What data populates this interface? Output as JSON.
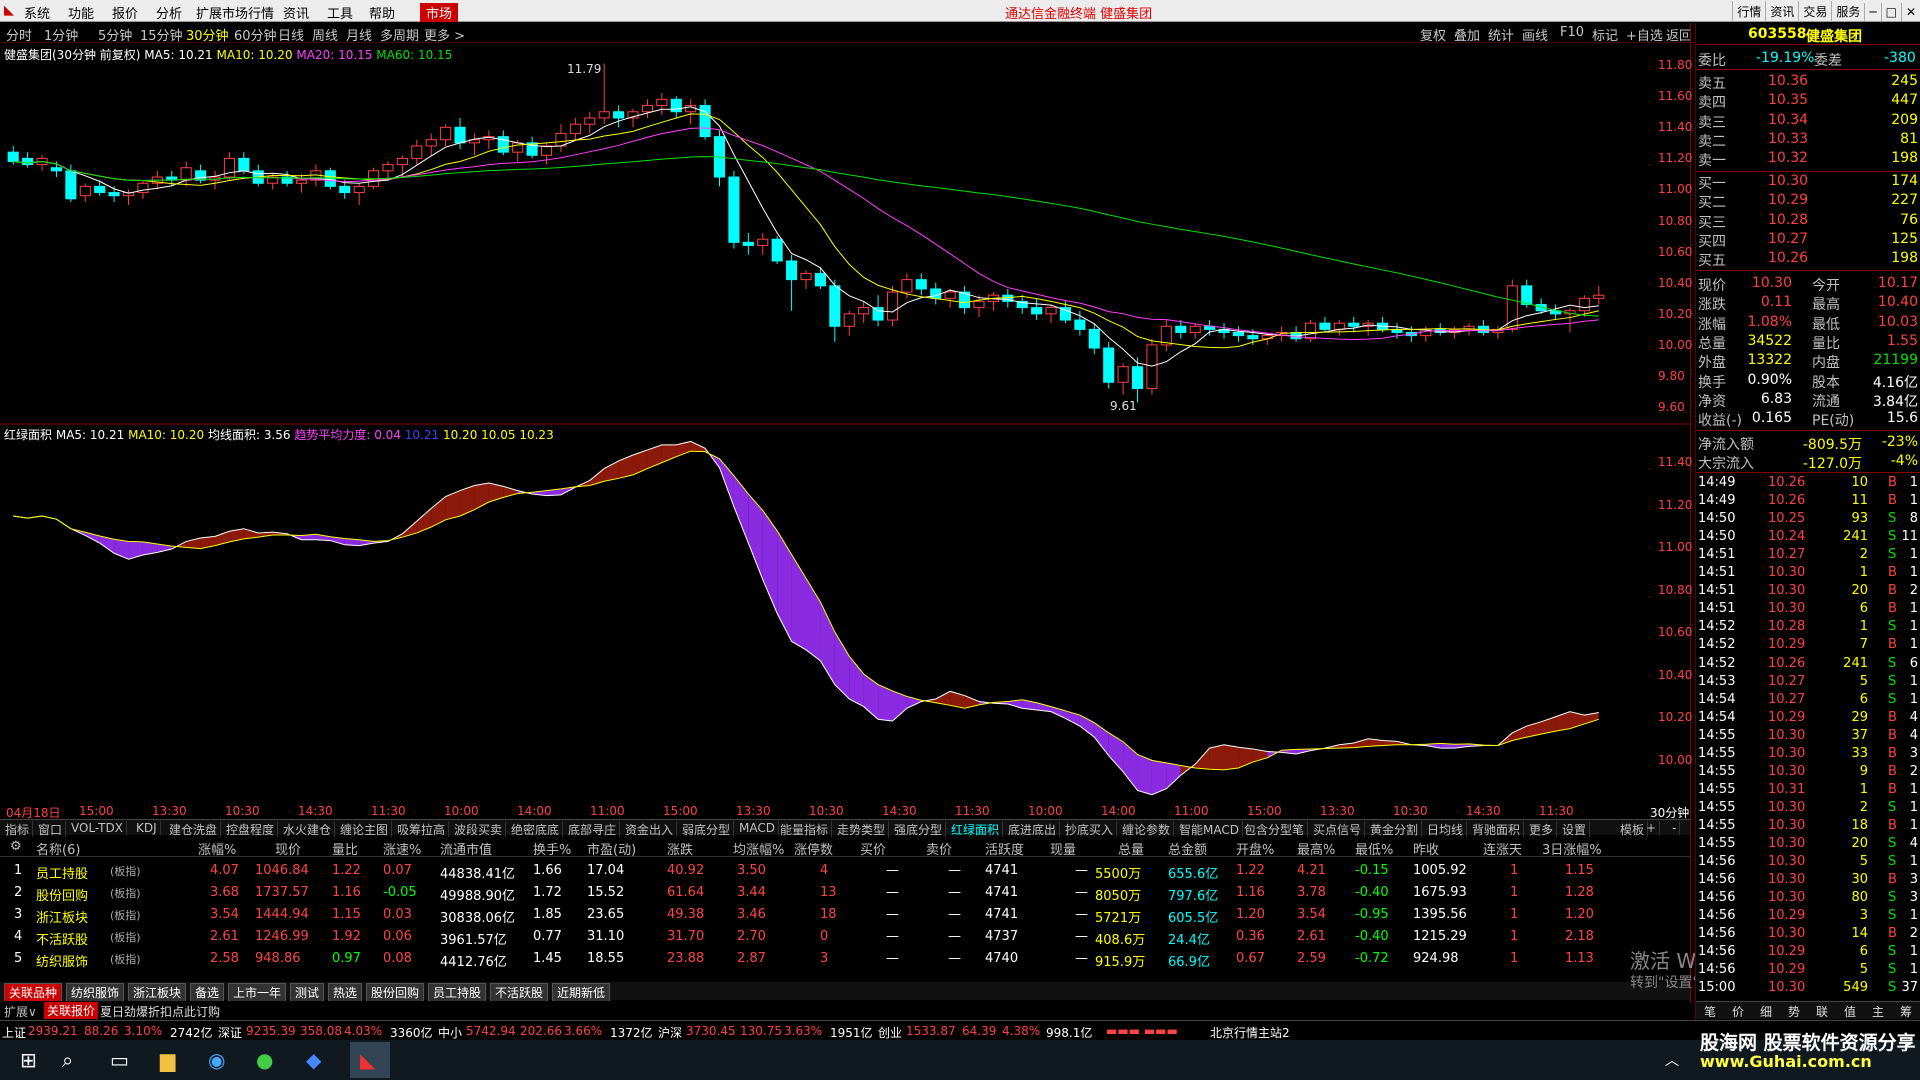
{
  "menu": {
    "items": [
      "系统",
      "功能",
      "报价",
      "分析",
      "扩展市场行情",
      "资讯",
      "工具",
      "帮助",
      "市场"
    ],
    "title": "通达信金融终端  健盛集团",
    "right": [
      "行情",
      "资讯",
      "交易",
      "服务"
    ]
  },
  "timeframes": [
    "分时",
    "1分钟",
    "5分钟",
    "15分钟",
    "30分钟",
    "60分钟",
    "日线",
    "周线",
    "月线",
    "多周期",
    "更多 >"
  ],
  "tf_right": [
    "复权",
    "叠加",
    "统计",
    "画线",
    "F10",
    "标记",
    "+自选",
    "返回"
  ],
  "kinfo": {
    "name": "健盛集团(30分钟 前复权)",
    "ma5": "MA5: 10.21",
    "ma10": "MA10: 10.20",
    "ma20": "MA20: 10.15",
    "ma60": "MA60: 10.15"
  },
  "k_high": "11.79",
  "k_low": "9.61",
  "axis1": [
    "11.80",
    "11.60",
    "11.40",
    "11.20",
    "11.00",
    "10.80",
    "10.60",
    "10.40",
    "10.20",
    "10.00",
    "9.80",
    "9.60"
  ],
  "ind2": {
    "name": "红绿面积",
    "ma5": "MA5: 10.21",
    "ma10": "MA10: 10.20",
    "area": "均线面积: 3.56",
    "trend": "趋势平均力度: 0.04",
    "v1": "10.21",
    "v2": "10.20",
    "v3": "10.05",
    "v4": "10.23"
  },
  "axis2": [
    "11.40",
    "11.20",
    "11.00",
    "10.80",
    "10.60",
    "10.40",
    "10.20",
    "10.00"
  ],
  "timeaxis": [
    "04月18日",
    "15:00",
    "13:30",
    "10:30",
    "14:30",
    "11:30",
    "10:00",
    "14:00",
    "11:00",
    "15:00",
    "13:30",
    "10:30",
    "14:30",
    "11:30",
    "10:00",
    "14:00",
    "11:00",
    "15:00",
    "13:30",
    "10:30",
    "14:30",
    "11:30"
  ],
  "timeaxis_right": "30分钟",
  "indtabs": [
    "指标",
    "窗口",
    "VOL-TDX",
    "KDJ",
    "建仓洗盘",
    "控盘程度",
    "水火建仓",
    "缠论主图",
    "吸筹拉高",
    "波段买卖",
    "绝密底底",
    "底部寻庄",
    "资金出入",
    "弱底分型",
    "MACD",
    "能量指标",
    "走势类型",
    "强底分型",
    "红绿面积",
    "底进底出",
    "抄底买入",
    "缠论参数",
    "智能MACD",
    "包含分型笔",
    "买点信号",
    "黄金分割",
    "日均线",
    "背驰面积",
    "更多",
    "设置"
  ],
  "indtabs_right": [
    "模板",
    "+",
    "-"
  ],
  "table": {
    "headers": [
      "名称(6)",
      "涨幅%",
      "现价",
      "量比",
      "涨速%",
      "流通市值",
      "换手%",
      "市盈(动)",
      "涨跌",
      "均涨幅%",
      "涨停数",
      "买价",
      "卖价",
      "活跃度",
      "现量",
      "总量",
      "总金额",
      "开盘%",
      "最高%",
      "最低%",
      "昨收",
      "连涨天",
      "3日涨幅%"
    ],
    "rows": [
      [
        "1",
        "员工持股",
        "(板指)",
        "4.07",
        "1046.84",
        "1.22",
        "0.07",
        "44838.41亿",
        "1.66",
        "17.04",
        "40.92",
        "3.50",
        "4",
        "—",
        "—",
        "4741",
        "—",
        "5500万",
        "655.6亿",
        "1.22",
        "4.21",
        "-0.15",
        "1005.92",
        "1",
        "1.15"
      ],
      [
        "2",
        "股份回购",
        "(板指)",
        "3.68",
        "1737.57",
        "1.16",
        "-0.05",
        "49988.90亿",
        "1.72",
        "15.52",
        "61.64",
        "3.44",
        "13",
        "—",
        "—",
        "4741",
        "—",
        "8050万",
        "797.6亿",
        "1.16",
        "3.78",
        "-0.40",
        "1675.93",
        "1",
        "1.28"
      ],
      [
        "3",
        "浙江板块",
        "(板指)",
        "3.54",
        "1444.94",
        "1.15",
        "0.03",
        "30838.06亿",
        "1.85",
        "23.65",
        "49.38",
        "3.46",
        "18",
        "—",
        "—",
        "4741",
        "—",
        "5721万",
        "605.5亿",
        "1.20",
        "3.54",
        "-0.95",
        "1395.56",
        "1",
        "1.20"
      ],
      [
        "4",
        "不活跃股",
        "(板指)",
        "2.61",
        "1246.99",
        "1.92",
        "0.06",
        "3961.57亿",
        "0.77",
        "31.10",
        "31.70",
        "2.70",
        "0",
        "—",
        "—",
        "4737",
        "—",
        "408.6万",
        "24.4亿",
        "0.36",
        "2.61",
        "-0.40",
        "1215.29",
        "1",
        "2.18"
      ],
      [
        "5",
        "纺织服饰",
        "(板指)",
        "2.58",
        "948.86",
        "0.97",
        "0.08",
        "4412.76亿",
        "1.45",
        "18.55",
        "23.88",
        "2.87",
        "3",
        "—",
        "—",
        "4740",
        "—",
        "915.9万",
        "66.9亿",
        "0.67",
        "2.59",
        "-0.72",
        "924.98",
        "1",
        "1.13"
      ]
    ]
  },
  "blocktabs": [
    "关联品种",
    "纺织服饰",
    "浙江板块",
    "备选",
    "上市一年",
    "测试",
    "热选",
    "股份回购",
    "员工持股",
    "不活跃股",
    "近期新低"
  ],
  "bar3": [
    "扩展∨",
    "关联报价",
    "夏日劲爆折扣点此订购"
  ],
  "status": {
    "sh": "上证",
    "sh_v": "2939.21",
    "sh_c": "88.26",
    "sh_p": "3.10%",
    "sh_a": "2742亿",
    "sz": "深证",
    "sz_v": "9235.39",
    "sz_c": "358.08",
    "sz_p": "4.03%",
    "sz_a": "3360亿",
    "zx": "中小",
    "zx_v": "5742.94",
    "zx_c": "202.66",
    "zx_p": "3.66%",
    "zx_a": "1372亿",
    "hs": "沪深",
    "hs_v": "3730.45",
    "hs_c": "130.75",
    "hs_p": "3.63%",
    "hs_a": "1951亿",
    "cy": "创业",
    "cy_v": "1533.87",
    "cy_c": "64.39",
    "cy_p": "4.38%",
    "cy_a": "998.1亿",
    "server": "北京行情主站2"
  },
  "quote": {
    "code": "603558",
    "name": "健盛集团",
    "wb_l": "委比",
    "wb": "-19.19%",
    "wc_l": "委差",
    "wc": "-380",
    "sells": [
      [
        "卖五",
        "10.36",
        "245"
      ],
      [
        "卖四",
        "10.35",
        "447"
      ],
      [
        "卖三",
        "10.34",
        "209"
      ],
      [
        "卖二",
        "10.33",
        "81"
      ],
      [
        "卖一",
        "10.32",
        "198"
      ]
    ],
    "buys": [
      [
        "买一",
        "10.30",
        "174"
      ],
      [
        "买二",
        "10.29",
        "227"
      ],
      [
        "买三",
        "10.28",
        "76"
      ],
      [
        "买四",
        "10.27",
        "125"
      ],
      [
        "买五",
        "10.26",
        "198"
      ]
    ],
    "stats": [
      [
        "现价",
        "10.30",
        "今开",
        "10.17"
      ],
      [
        "涨跌",
        "0.11",
        "最高",
        "10.40"
      ],
      [
        "涨幅",
        "1.08%",
        "最低",
        "10.03"
      ],
      [
        "总量",
        "34522",
        "量比",
        "1.55"
      ],
      [
        "外盘",
        "13322",
        "内盘",
        "21199"
      ],
      [
        "换手",
        "0.90%",
        "股本",
        "4.16亿"
      ],
      [
        "净资",
        "6.83",
        "流通",
        "3.84亿"
      ],
      [
        "收益(-)",
        "0.165",
        "PE(动)",
        "15.6"
      ]
    ],
    "flow": [
      [
        "净流入额",
        "-809.5万",
        "-23%"
      ],
      [
        "大宗流入",
        "-127.0万",
        "-4%"
      ]
    ],
    "ticks": [
      [
        "14:49",
        "10.26",
        "10",
        "B",
        "1"
      ],
      [
        "14:49",
        "10.26",
        "11",
        "B",
        "1"
      ],
      [
        "14:50",
        "10.25",
        "93",
        "S",
        "8"
      ],
      [
        "14:50",
        "10.24",
        "241",
        "S",
        "11"
      ],
      [
        "14:51",
        "10.27",
        "2",
        "S",
        "1"
      ],
      [
        "14:51",
        "10.30",
        "1",
        "B",
        "1"
      ],
      [
        "14:51",
        "10.30",
        "20",
        "B",
        "2"
      ],
      [
        "14:51",
        "10.30",
        "6",
        "B",
        "1"
      ],
      [
        "14:52",
        "10.28",
        "1",
        "S",
        "1"
      ],
      [
        "14:52",
        "10.29",
        "7",
        "B",
        "1"
      ],
      [
        "14:52",
        "10.26",
        "241",
        "S",
        "6"
      ],
      [
        "14:53",
        "10.27",
        "5",
        "S",
        "1"
      ],
      [
        "14:54",
        "10.27",
        "6",
        "S",
        "1"
      ],
      [
        "14:54",
        "10.29",
        "29",
        "B",
        "4"
      ],
      [
        "14:55",
        "10.30",
        "37",
        "B",
        "4"
      ],
      [
        "14:55",
        "10.30",
        "33",
        "B",
        "3"
      ],
      [
        "14:55",
        "10.30",
        "9",
        "B",
        "2"
      ],
      [
        "14:55",
        "10.31",
        "1",
        "B",
        "1"
      ],
      [
        "14:55",
        "10.30",
        "2",
        "S",
        "1"
      ],
      [
        "14:55",
        "10.30",
        "18",
        "B",
        "1"
      ],
      [
        "14:55",
        "10.30",
        "20",
        "S",
        "4"
      ],
      [
        "14:56",
        "10.30",
        "5",
        "S",
        "1"
      ],
      [
        "14:56",
        "10.30",
        "30",
        "B",
        "3"
      ],
      [
        "14:56",
        "10.30",
        "80",
        "S",
        "3"
      ],
      [
        "14:56",
        "10.29",
        "3",
        "S",
        "1"
      ],
      [
        "14:56",
        "10.30",
        "14",
        "B",
        "2"
      ],
      [
        "14:56",
        "10.29",
        "6",
        "S",
        "1"
      ],
      [
        "14:56",
        "10.29",
        "5",
        "S",
        "1"
      ],
      [
        "15:00",
        "10.30",
        "549",
        "S",
        "37"
      ]
    ],
    "bottom_tabs": [
      "笔",
      "价",
      "细",
      "势",
      "联",
      "值",
      "主",
      "筹"
    ]
  },
  "watermark": [
    "激活 Windows",
    "转到\"设置\"以激活 Windows。"
  ],
  "brand": "股海网 股票软件资源分享",
  "brand_url": "www.Guhai.com.cn",
  "colors": {
    "up": "#ff4040",
    "down": "#00ffff",
    "ma5": "#ffffff",
    "ma10": "#ffff00",
    "ma20": "#ff40ff",
    "ma60": "#00e000",
    "area_up": "#8b1a0a",
    "area_down": "#8a2be2"
  }
}
